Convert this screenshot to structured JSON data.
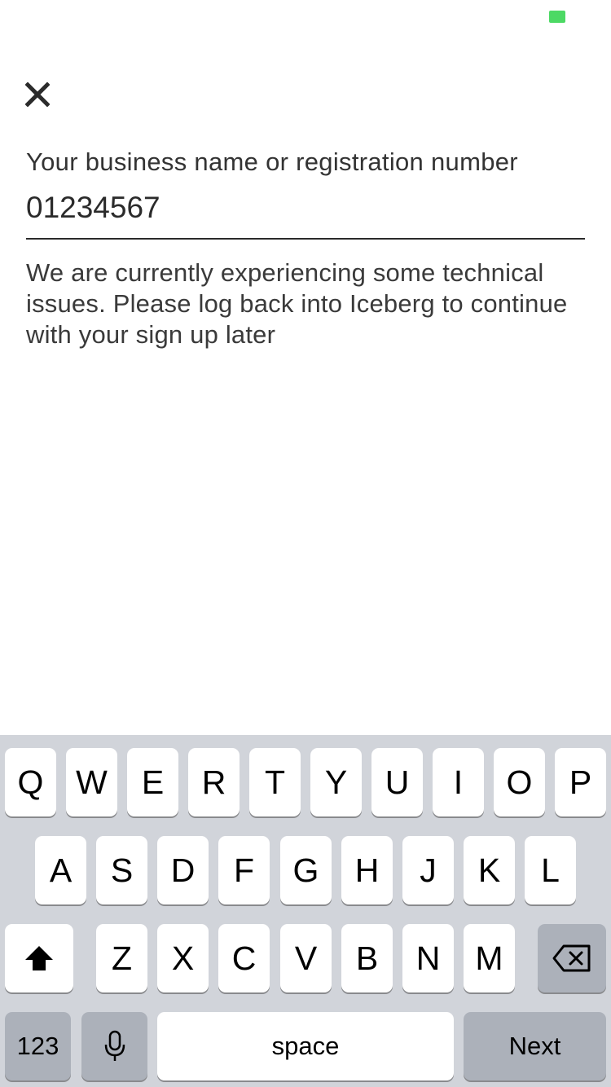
{
  "status_bar": {
    "battery_color": "#4cd964"
  },
  "header": {
    "close_icon": "close-icon"
  },
  "form": {
    "label": "Your business name or registration number",
    "input_value": "01234567",
    "error_message": "We are currently experiencing some technical issues. Please log back into Iceberg to continue with your sign up later"
  },
  "keyboard": {
    "row1": [
      "Q",
      "W",
      "E",
      "R",
      "T",
      "Y",
      "U",
      "I",
      "O",
      "P"
    ],
    "row2": [
      "A",
      "S",
      "D",
      "F",
      "G",
      "H",
      "J",
      "K",
      "L"
    ],
    "row3": [
      "Z",
      "X",
      "C",
      "V",
      "B",
      "N",
      "M"
    ],
    "shift_icon": "shift-icon",
    "backspace_icon": "backspace-icon",
    "numbers_label": "123",
    "mic_icon": "microphone-icon",
    "space_label": "space",
    "return_label": "Next"
  }
}
